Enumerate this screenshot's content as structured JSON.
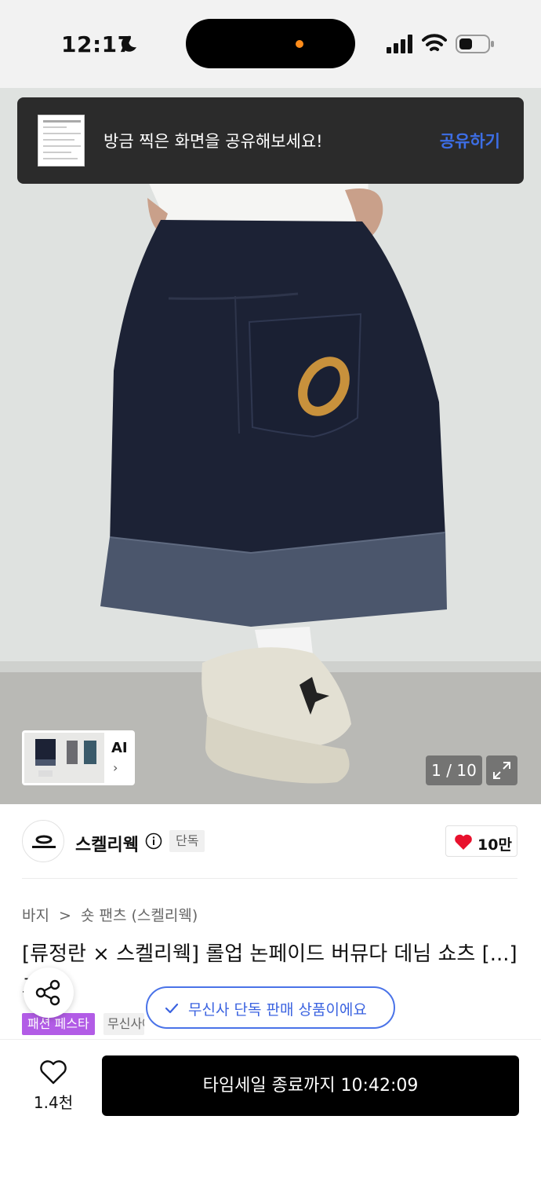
{
  "status_bar": {
    "time": "12:17"
  },
  "toast": {
    "message": "방금 찍은 화면을 공유해보세요!",
    "action_label": "공유하기"
  },
  "gallery": {
    "ai_label": "AI",
    "ai_chevron": "›",
    "counter": "1 / 10"
  },
  "brand": {
    "name": "스켈리웩",
    "exclusive_label": "단독",
    "likes": "10만"
  },
  "breadcrumb": {
    "category": "바지",
    "separator": ">",
    "subcategory": "숏 팬츠 (스켈리웩)"
  },
  "product": {
    "title": "[류정란 × 스켈리웩] 롤업 논페이드 버뮤다 데님 쇼츠 [...] 고]"
  },
  "notice": {
    "text": "무신사 단독 판매 상품이에요"
  },
  "tags": {
    "fashion_festa": "패션 페스타",
    "musinsa": "무신사에"
  },
  "bottom_bar": {
    "wish_count": "1.4천",
    "buy_label": "타임세일 종료까지 10:42:09"
  },
  "colors": {
    "accent_blue": "#3b63e0",
    "like_red": "#e8112d",
    "festa_purple": "#b25ce6"
  },
  "icons": [
    "moon-icon",
    "signal-icon",
    "wifi-icon",
    "battery-icon",
    "expand-icon",
    "info-icon",
    "heart-icon",
    "share-icon",
    "check-icon",
    "heart-outline-icon"
  ]
}
